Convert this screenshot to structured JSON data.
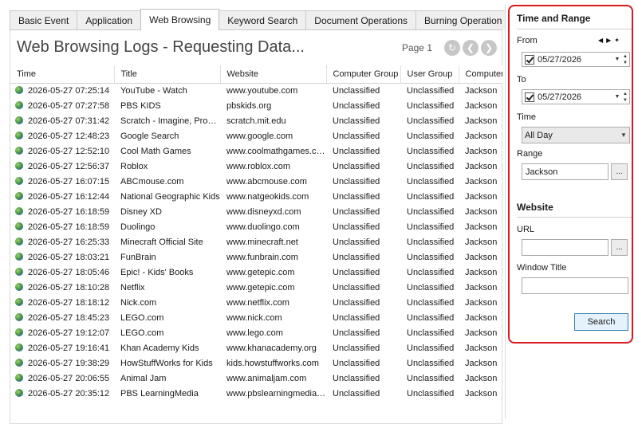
{
  "tabs": [
    {
      "label": "Basic Event",
      "active": false
    },
    {
      "label": "Application",
      "active": false
    },
    {
      "label": "Web Browsing",
      "active": true
    },
    {
      "label": "Keyword Search",
      "active": false
    },
    {
      "label": "Document Operations",
      "active": false
    },
    {
      "label": "Burning Operation",
      "active": false
    }
  ],
  "tabs_overflow_icon": "scroll-right-icon",
  "page_title": "Web Browsing Logs - Requesting Data...",
  "pager": {
    "label": "Page 1",
    "buttons": [
      "first-page-icon",
      "previous-page-icon",
      "next-page-icon"
    ]
  },
  "columns": [
    "Time",
    "Title",
    "Website",
    "Computer Group",
    "User Group",
    "Computer"
  ],
  "rows": [
    {
      "time": "2026-05-27 07:25:14",
      "title": "YouTube - Watch",
      "website": "www.youtube.com",
      "computer_group": "Unclassified",
      "user_group": "Unclassified",
      "computer": "Jackson"
    },
    {
      "time": "2026-05-27 07:27:58",
      "title": "PBS KIDS",
      "website": "pbskids.org",
      "computer_group": "Unclassified",
      "user_group": "Unclassified",
      "computer": "Jackson"
    },
    {
      "time": "2026-05-27 07:31:42",
      "title": "Scratch - Imagine, Program...",
      "website": "scratch.mit.edu",
      "computer_group": "Unclassified",
      "user_group": "Unclassified",
      "computer": "Jackson"
    },
    {
      "time": "2026-05-27 12:48:23",
      "title": "Google Search",
      "website": "www.google.com",
      "computer_group": "Unclassified",
      "user_group": "Unclassified",
      "computer": "Jackson"
    },
    {
      "time": "2026-05-27 12:52:10",
      "title": "Cool Math Games",
      "website": "www.coolmathgames.com",
      "computer_group": "Unclassified",
      "user_group": "Unclassified",
      "computer": "Jackson"
    },
    {
      "time": "2026-05-27 12:56:37",
      "title": "Roblox",
      "website": "www.roblox.com",
      "computer_group": "Unclassified",
      "user_group": "Unclassified",
      "computer": "Jackson"
    },
    {
      "time": "2026-05-27 16:07:15",
      "title": "ABCmouse.com",
      "website": "www.abcmouse.com",
      "computer_group": "Unclassified",
      "user_group": "Unclassified",
      "computer": "Jackson"
    },
    {
      "time": "2026-05-27 16:12:44",
      "title": "National Geographic Kids",
      "website": "www.natgeokids.com",
      "computer_group": "Unclassified",
      "user_group": "Unclassified",
      "computer": "Jackson"
    },
    {
      "time": "2026-05-27 16:18:59",
      "title": "Disney XD",
      "website": "www.disneyxd.com",
      "computer_group": "Unclassified",
      "user_group": "Unclassified",
      "computer": "Jackson"
    },
    {
      "time": "2026-05-27 16:18:59",
      "title": "Duolingo",
      "website": "www.duolingo.com",
      "computer_group": "Unclassified",
      "user_group": "Unclassified",
      "computer": "Jackson"
    },
    {
      "time": "2026-05-27 16:25:33",
      "title": "Minecraft Official Site",
      "website": "www.minecraft.net",
      "computer_group": "Unclassified",
      "user_group": "Unclassified",
      "computer": "Jackson"
    },
    {
      "time": "2026-05-27 18:03:21",
      "title": "FunBrain",
      "website": "www.funbrain.com",
      "computer_group": "Unclassified",
      "user_group": "Unclassified",
      "computer": "Jackson"
    },
    {
      "time": "2026-05-27 18:05:46",
      "title": "Epic! - Kids' Books",
      "website": "www.getepic.com",
      "computer_group": "Unclassified",
      "user_group": "Unclassified",
      "computer": "Jackson"
    },
    {
      "time": "2026-05-27 18:10:28",
      "title": "Netflix",
      "website": "www.getepic.com",
      "computer_group": "Unclassified",
      "user_group": "Unclassified",
      "computer": "Jackson"
    },
    {
      "time": "2026-05-27 18:18:12",
      "title": "Nick.com",
      "website": "www.netflix.com",
      "computer_group": "Unclassified",
      "user_group": "Unclassified",
      "computer": "Jackson"
    },
    {
      "time": "2026-05-27 18:45:23",
      "title": "LEGO.com",
      "website": "www.nick.com",
      "computer_group": "Unclassified",
      "user_group": "Unclassified",
      "computer": "Jackson"
    },
    {
      "time": "2026-05-27 19:12:07",
      "title": "LEGO.com",
      "website": "www.lego.com",
      "computer_group": "Unclassified",
      "user_group": "Unclassified",
      "computer": "Jackson"
    },
    {
      "time": "2026-05-27 19:16:41",
      "title": "Khan Academy Kids",
      "website": "www.khanacademy.org",
      "computer_group": "Unclassified",
      "user_group": "Unclassified",
      "computer": "Jackson"
    },
    {
      "time": "2026-05-27 19:38:29",
      "title": "HowStuffWorks for Kids",
      "website": "kids.howstuffworks.com",
      "computer_group": "Unclassified",
      "user_group": "Unclassified",
      "computer": "Jackson"
    },
    {
      "time": "2026-05-27 20:06:55",
      "title": "Animal Jam",
      "website": "www.animaljam.com",
      "computer_group": "Unclassified",
      "user_group": "Unclassified",
      "computer": "Jackson"
    },
    {
      "time": "2026-05-27 20:35:12",
      "title": "PBS LearningMedia",
      "website": "www.pbslearningmedia.org",
      "computer_group": "Unclassified",
      "user_group": "Unclassified",
      "computer": "Jackson"
    }
  ],
  "filter": {
    "highlight_color": "#d9191f",
    "time_range": {
      "heading": "Time and Range",
      "from_label": "From",
      "from_value": "05/27/2026",
      "to_label": "To",
      "to_value": "05/27/2026",
      "time_label": "Time",
      "time_value": "All Day",
      "range_label": "Range",
      "range_value": "Jackson",
      "range_button": "..."
    },
    "website": {
      "heading": "Website",
      "url_label": "URL",
      "url_value": "",
      "url_button": "...",
      "window_title_label": "Window Title",
      "window_title_value": ""
    },
    "search_button": "Search"
  }
}
